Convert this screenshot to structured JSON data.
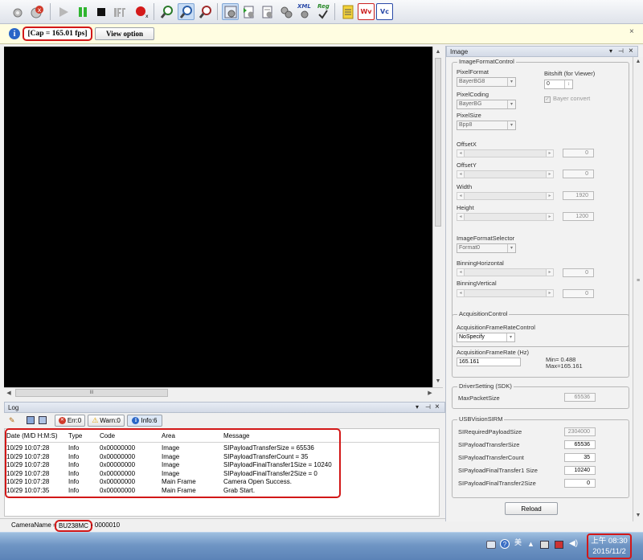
{
  "toolbar": {
    "icons": [
      "camera-settings-icon",
      "camera-open-icon",
      "play-icon",
      "pause-icon",
      "stop-icon",
      "trigger-icon",
      "record-icon",
      "zoom-in-icon",
      "zoom-fit-icon",
      "zoom-out-icon",
      "config-icon",
      "config-load-icon",
      "config-save-icon",
      "config-reset-icon",
      "xml-icon",
      "register-icon",
      "notepad-icon",
      "waveform-icon",
      "vc-icon"
    ],
    "xml_label": "XML",
    "reg_label": "Reg",
    "wv_label": "Wv",
    "vc_label": "Vc"
  },
  "infobar": {
    "cap": "[Cap = 165.01 fps]",
    "view_option": "View option"
  },
  "viewer": {
    "scroll_label": "III"
  },
  "log": {
    "title": "Log",
    "tabs": {
      "err": "Err:0",
      "warn": "Warn:0",
      "info": "Info:6"
    },
    "columns": [
      "Date (M/D H:M:S)",
      "Type",
      "Code",
      "Area",
      "Message"
    ],
    "rows": [
      [
        "10/29 10:07:28",
        "Info",
        "0x00000000",
        "Image",
        "SIPayloadTransferSize = 65536"
      ],
      [
        "10/29 10:07:28",
        "Info",
        "0x00000000",
        "Image",
        "SIPayloadTransferCount = 35"
      ],
      [
        "10/29 10:07:28",
        "Info",
        "0x00000000",
        "Image",
        "SIPayloadFinalTransfer1Size = 10240"
      ],
      [
        "10/29 10:07:28",
        "Info",
        "0x00000000",
        "Image",
        "SIPayloadFinalTransfer2Size = 0"
      ],
      [
        "10/29 10:07:28",
        "Info",
        "0x00000000",
        "Main Frame",
        "Camera Open Success."
      ],
      [
        "10/29 10:07:35",
        "Info",
        "0x00000000",
        "Main Frame",
        "Grab Start."
      ]
    ]
  },
  "status": {
    "camera_name_label": "CameraName =",
    "model": "BU238MC",
    "serial": "- 0000010"
  },
  "panel": {
    "title": "Image",
    "image_format": {
      "title": "ImageFormatControl",
      "pixel_format_label": "PixelFormat",
      "pixel_format": "BayerBG8",
      "bitshift_label": "Bitshift (for Viewer)",
      "bitshift": "0",
      "bayer_convert": "Bayer convert",
      "pixel_coding_label": "PixelCoding",
      "pixel_coding": "BayerBG",
      "pixel_size_label": "PixelSize",
      "pixel_size": "Bpp8",
      "offset_x_label": "OffsetX",
      "offset_x": "0",
      "offset_y_label": "OffsetY",
      "offset_y": "0",
      "width_label": "Width",
      "width": "1920",
      "height_label": "Height",
      "height": "1200",
      "selector_label": "ImageFormatSelector",
      "selector": "Format0",
      "bin_h_label": "BinningHorizontal",
      "bin_h": "0",
      "bin_v_label": "BinningVertical",
      "bin_v": "0"
    },
    "acquisition": {
      "title": "AcquisitionControl",
      "frame_rate_control_label": "AcquisitionFrameRateControl",
      "frame_rate_control": "NoSpecify",
      "frame_rate_label": "AcquisitionFrameRate (Hz)",
      "frame_rate": "165.161",
      "min": "Min= 0.488",
      "max": "Max=165.161"
    },
    "driver": {
      "title": "DriverSetting (SDK)",
      "max_packet_label": "MaxPacketSize",
      "max_packet": "65536"
    },
    "usb": {
      "title": "USBVisionSIRM",
      "req_payload_label": "SIRequiredPayloadSize",
      "req_payload": "2304000",
      "transfer_size_label": "SIPayloadTransferSize",
      "transfer_size": "65536",
      "transfer_count_label": "SIPayloadTransferCount",
      "transfer_count": "35",
      "final1_label": "SIPayloadFinalTransfer1 Size",
      "final1": "10240",
      "final2_label": "SIPayloadFinalTransfer2Size",
      "final2": "0"
    },
    "reload": "Reload"
  },
  "taskbar": {
    "ime": "美",
    "time": "上午 08:30",
    "date": "2015/11/2"
  }
}
